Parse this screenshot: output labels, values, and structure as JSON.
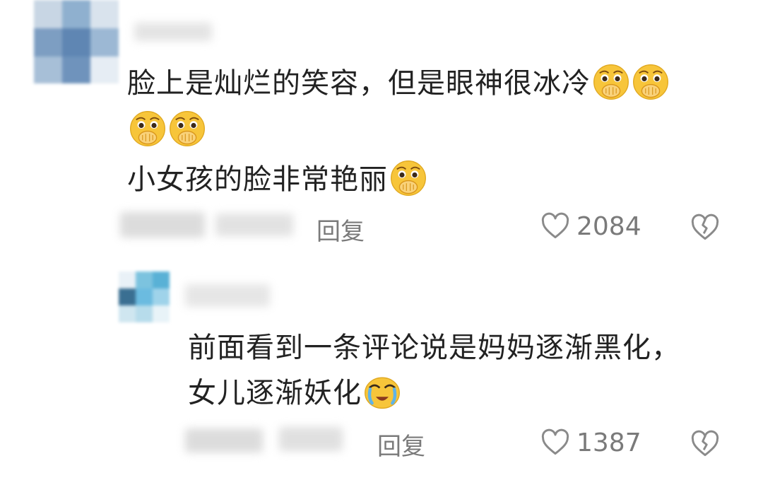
{
  "comments": [
    {
      "text_line1": "脸上是灿烂的笑容，但是眼神很冰冷",
      "text_line3": "小女孩的脸非常艳丽",
      "emoji_name": "hand-over-mouth-emoji",
      "reply_label": "回复",
      "likes": "2084"
    },
    {
      "text_line1": "前面看到一条评论说是妈妈逐渐黑化，",
      "text_line2": "女儿逐渐妖化",
      "emoji_name": "crying-face-emoji",
      "reply_label": "回复",
      "likes": "1387"
    }
  ],
  "colors": {
    "text": "#222222",
    "meta": "#7a7a7a",
    "emoji_yellow": "#f7c53a"
  },
  "icons": [
    "heart-outline-icon",
    "broken-heart-icon"
  ]
}
